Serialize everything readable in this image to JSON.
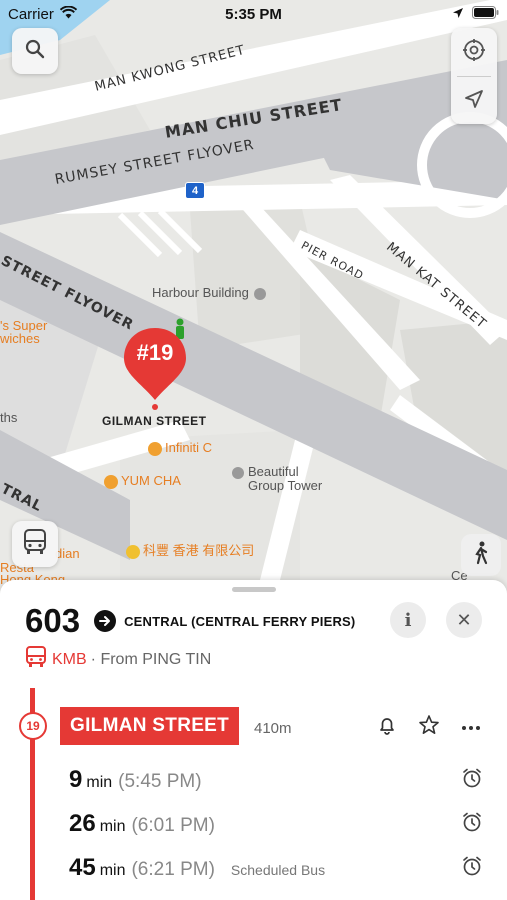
{
  "status": {
    "carrier": "Carrier",
    "time": "5:35 PM"
  },
  "map": {
    "roads": {
      "man_kwong": "MAN KWONG STREET",
      "man_chiu": "MAN CHIU STREET",
      "rumsey_flyover": "RUMSEY STREET FLYOVER",
      "route_shield": "4",
      "pier_road": "PIER ROAD",
      "man_kat": "MAN KAT STREET",
      "street_flyover": "STREET FLYOVER",
      "tral": "TRAL"
    },
    "pois": {
      "harbour_building": "Harbour Building",
      "super_line1": "'s Super",
      "super_line2": "wiches",
      "infiniti": "Infiniti C",
      "yum_cha": "YUM CHA",
      "beautiful_line1": "Beautiful",
      "beautiful_line2": "Group Tower",
      "kefeng": "科豐 香港 有限公司",
      "dian": "dian",
      "resta": "Resta",
      "hong_kong": "Hong Kong",
      "ths": "ths",
      "ce": "Ce"
    },
    "pin_label": "#19",
    "stop_label": "GILMAN STREET"
  },
  "sheet": {
    "route_number": "603",
    "destination": "CENTRAL (CENTRAL FERRY PIERS)",
    "info_label": "i",
    "close_label": "✕",
    "operator": "KMB",
    "from": "· From PING TIN",
    "stop_sequence": "19",
    "stop_name": "GILMAN STREET",
    "stop_distance": "410m",
    "etas": [
      {
        "minutes": "9",
        "unit": "min",
        "time": "(5:45 PM)",
        "note": ""
      },
      {
        "minutes": "26",
        "unit": "min",
        "time": "(6:01 PM)",
        "note": ""
      },
      {
        "minutes": "45",
        "unit": "min",
        "time": "(6:21 PM)",
        "note": "Scheduled Bus"
      }
    ]
  },
  "colors": {
    "accent": "#e53935",
    "map_bg": "#e9e9e6",
    "road": "#ffffff",
    "flyover": "#c6c7cb",
    "poi_orange": "#e67e22",
    "poi_gray": "#555555"
  },
  "icons": {
    "search": "search-icon",
    "settings": "settings-icon",
    "locate": "location-arrow-icon",
    "bus": "bus-icon",
    "walk": "walking-icon",
    "bell": "bell-icon",
    "star": "star-icon",
    "more": "more-icon",
    "alarm": "alarm-clock-icon"
  }
}
